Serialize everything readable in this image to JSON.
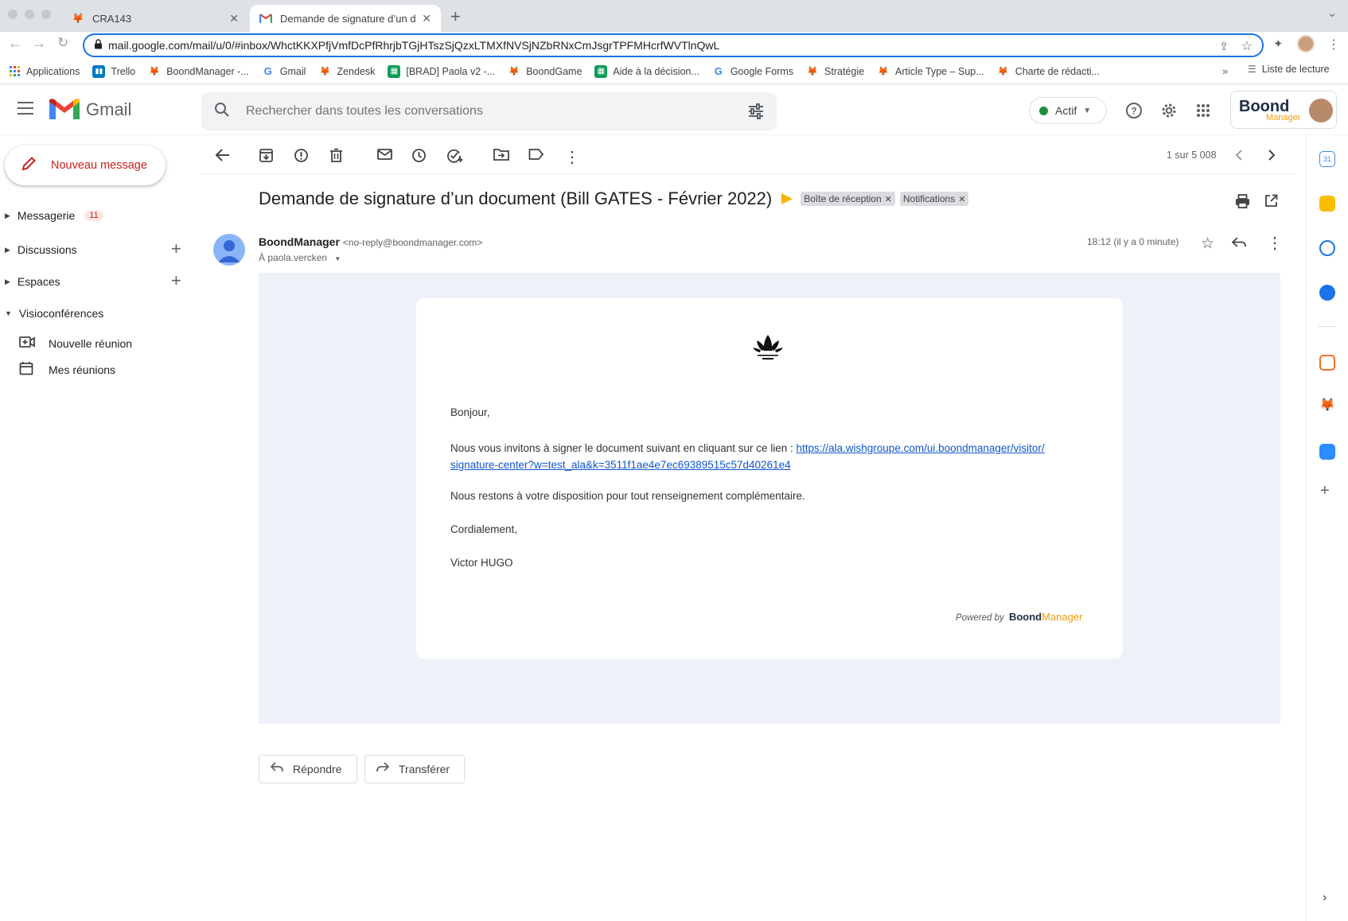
{
  "browser": {
    "tabs": [
      {
        "title": "CRA143",
        "active": false
      },
      {
        "title": "Demande de signature d’un do",
        "active": true
      }
    ],
    "url": "mail.google.com/mail/u/0/#inbox/WhctKKXPfjVmfDcPfRhrjbTGjHTszSjQzxLTMXfNVSjNZbRNxCmJsgrTPFMHcrfWVTlnQwL",
    "bookmarks": [
      {
        "label": "Applications",
        "icon": "apps-grid-icon"
      },
      {
        "label": "Trello",
        "icon": "trello-icon"
      },
      {
        "label": "BoondManager -...",
        "icon": "fox-icon"
      },
      {
        "label": "Gmail",
        "icon": "google-icon"
      },
      {
        "label": "Zendesk",
        "icon": "fox-icon"
      },
      {
        "label": "[BRAD] Paola v2 -...",
        "icon": "sheets-icon"
      },
      {
        "label": "BoondGame",
        "icon": "fox-icon"
      },
      {
        "label": "Aide à la décision...",
        "icon": "sheets-icon"
      },
      {
        "label": "Google Forms",
        "icon": "google-icon"
      },
      {
        "label": "Stratégie",
        "icon": "fox-icon"
      },
      {
        "label": "Article Type – Sup...",
        "icon": "fox-icon"
      },
      {
        "label": "Charte de rédacti...",
        "icon": "fox-icon"
      }
    ],
    "bookmarks_more": "»",
    "reading_list": "Liste de lecture"
  },
  "gmail": {
    "logo_text": "Gmail",
    "search_placeholder": "Rechercher dans toutes les conversations",
    "status": "Actif",
    "account": {
      "brand_bold": "Boond",
      "brand_sub": "Manager"
    }
  },
  "nav": {
    "compose": "Nouveau message",
    "sections": [
      {
        "label": "Messagerie",
        "badge": "11"
      },
      {
        "label": "Discussions"
      },
      {
        "label": "Espaces"
      },
      {
        "label": "Visioconférences"
      }
    ],
    "meet_items": [
      "Nouvelle réunion",
      "Mes réunions"
    ]
  },
  "toolbar": {
    "counter": "1 sur 5 008"
  },
  "message": {
    "subject": "Demande de signature d’un document (Bill GATES - Février 2022)",
    "labels": [
      "Boîte de réception",
      "Notifications"
    ],
    "sender_name": "BoondManager",
    "sender_email": "<no-reply@boondmanager.com>",
    "to": "À paola.vercken",
    "time": "18:12 (il y a 0 minute)",
    "body": {
      "greeting": "Bonjour,",
      "intro": "Nous vous invitons à signer le document suivant en cliquant sur ce lien : ",
      "link_line1": "https://ala.wishgroupe.com/ui.boondmanager/visitor/",
      "link_line2": "signature-center?w=test_ala&k=3511f1ae4e7ec69389515c57d40261e4",
      "availability": "Nous restons à votre disposition pour tout renseignement complémentaire.",
      "closing": "Cordialement,",
      "signature": "Victor HUGO",
      "powered_by": "Powered by",
      "powered_brand_bold": "Boond",
      "powered_brand_color": "Manager"
    }
  },
  "actions": {
    "reply": "Répondre",
    "forward": "Transférer"
  },
  "colors": {
    "accent_blue": "#1a73e8",
    "compose_red": "#c5221f",
    "boond_orange": "#f39c12",
    "important_yellow": "#f4b400",
    "email_bg": "#eef2f8"
  }
}
